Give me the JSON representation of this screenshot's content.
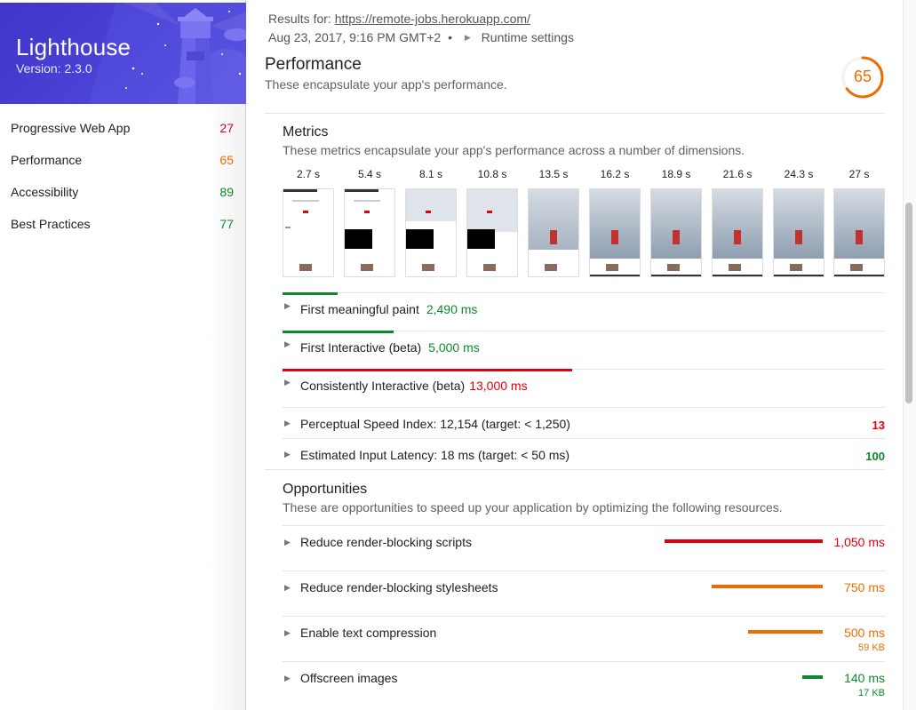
{
  "sidebar": {
    "title": "Lighthouse",
    "version": "Version: 2.3.0",
    "categories": [
      {
        "label": "Progressive Web App",
        "score": "27",
        "color": "#e0000f"
      },
      {
        "label": "Performance",
        "score": "65",
        "color": "#ef6c00"
      },
      {
        "label": "Accessibility",
        "score": "89",
        "color": "#0b8a2d"
      },
      {
        "label": "Best Practices",
        "score": "77",
        "color": "#0b8a2d"
      }
    ]
  },
  "header": {
    "results_prefix": "Results for:",
    "url": "https://remote-jobs.herokuapp.com/",
    "date": "Aug 23, 2017, 9:16 PM GMT+2",
    "bullet": "•",
    "runtime_settings": "Runtime settings"
  },
  "performance": {
    "title": "Performance",
    "description": "These encapsulate your app's performance.",
    "score": "65",
    "score_color": "#ef6c00"
  },
  "metrics": {
    "title": "Metrics",
    "description": "These metrics encapsulate your app's performance across a number of dimensions.",
    "filmstrip_times": [
      "2.7 s",
      "5.4 s",
      "8.1 s",
      "10.8 s",
      "13.5 s",
      "16.2 s",
      "18.9 s",
      "21.6 s",
      "24.3 s",
      "27 s"
    ],
    "items": [
      {
        "label": "First meaningful paint",
        "value": "2,490 ms",
        "color": "#0b8a2d",
        "bar_fraction": 0.092
      },
      {
        "label": "First Interactive (beta)",
        "value": "5,000 ms",
        "color": "#0b8a2d",
        "bar_fraction": 0.185
      },
      {
        "label": "Consistently Interactive (beta)",
        "value": "13,000 ms",
        "color": "#e0000f",
        "bar_fraction": 0.481
      },
      {
        "label": "Perceptual Speed Index: 12,154 (target: < 1,250)",
        "score": "13",
        "color": "#e0000f"
      },
      {
        "label": "Estimated Input Latency: 18 ms (target: < 50 ms)",
        "score": "100",
        "color": "#0b8a2d"
      }
    ]
  },
  "opportunities": {
    "title": "Opportunities",
    "description": "These are opportunities to speed up your application by optimizing the following resources.",
    "items": [
      {
        "label": "Reduce render-blocking scripts",
        "ms": "1,050 ms",
        "kb": "",
        "color": "#e0000f",
        "fraction": 1.0
      },
      {
        "label": "Reduce render-blocking stylesheets",
        "ms": "750 ms",
        "kb": "",
        "color": "#ef6c00",
        "fraction": 0.7
      },
      {
        "label": "Enable text compression",
        "ms": "500 ms",
        "kb": "59 KB",
        "color": "#ef6c00",
        "fraction": 0.47
      },
      {
        "label": "Offscreen images",
        "ms": "140 ms",
        "kb": "17 KB",
        "color": "#0b8a2d",
        "fraction": 0.13
      }
    ]
  }
}
